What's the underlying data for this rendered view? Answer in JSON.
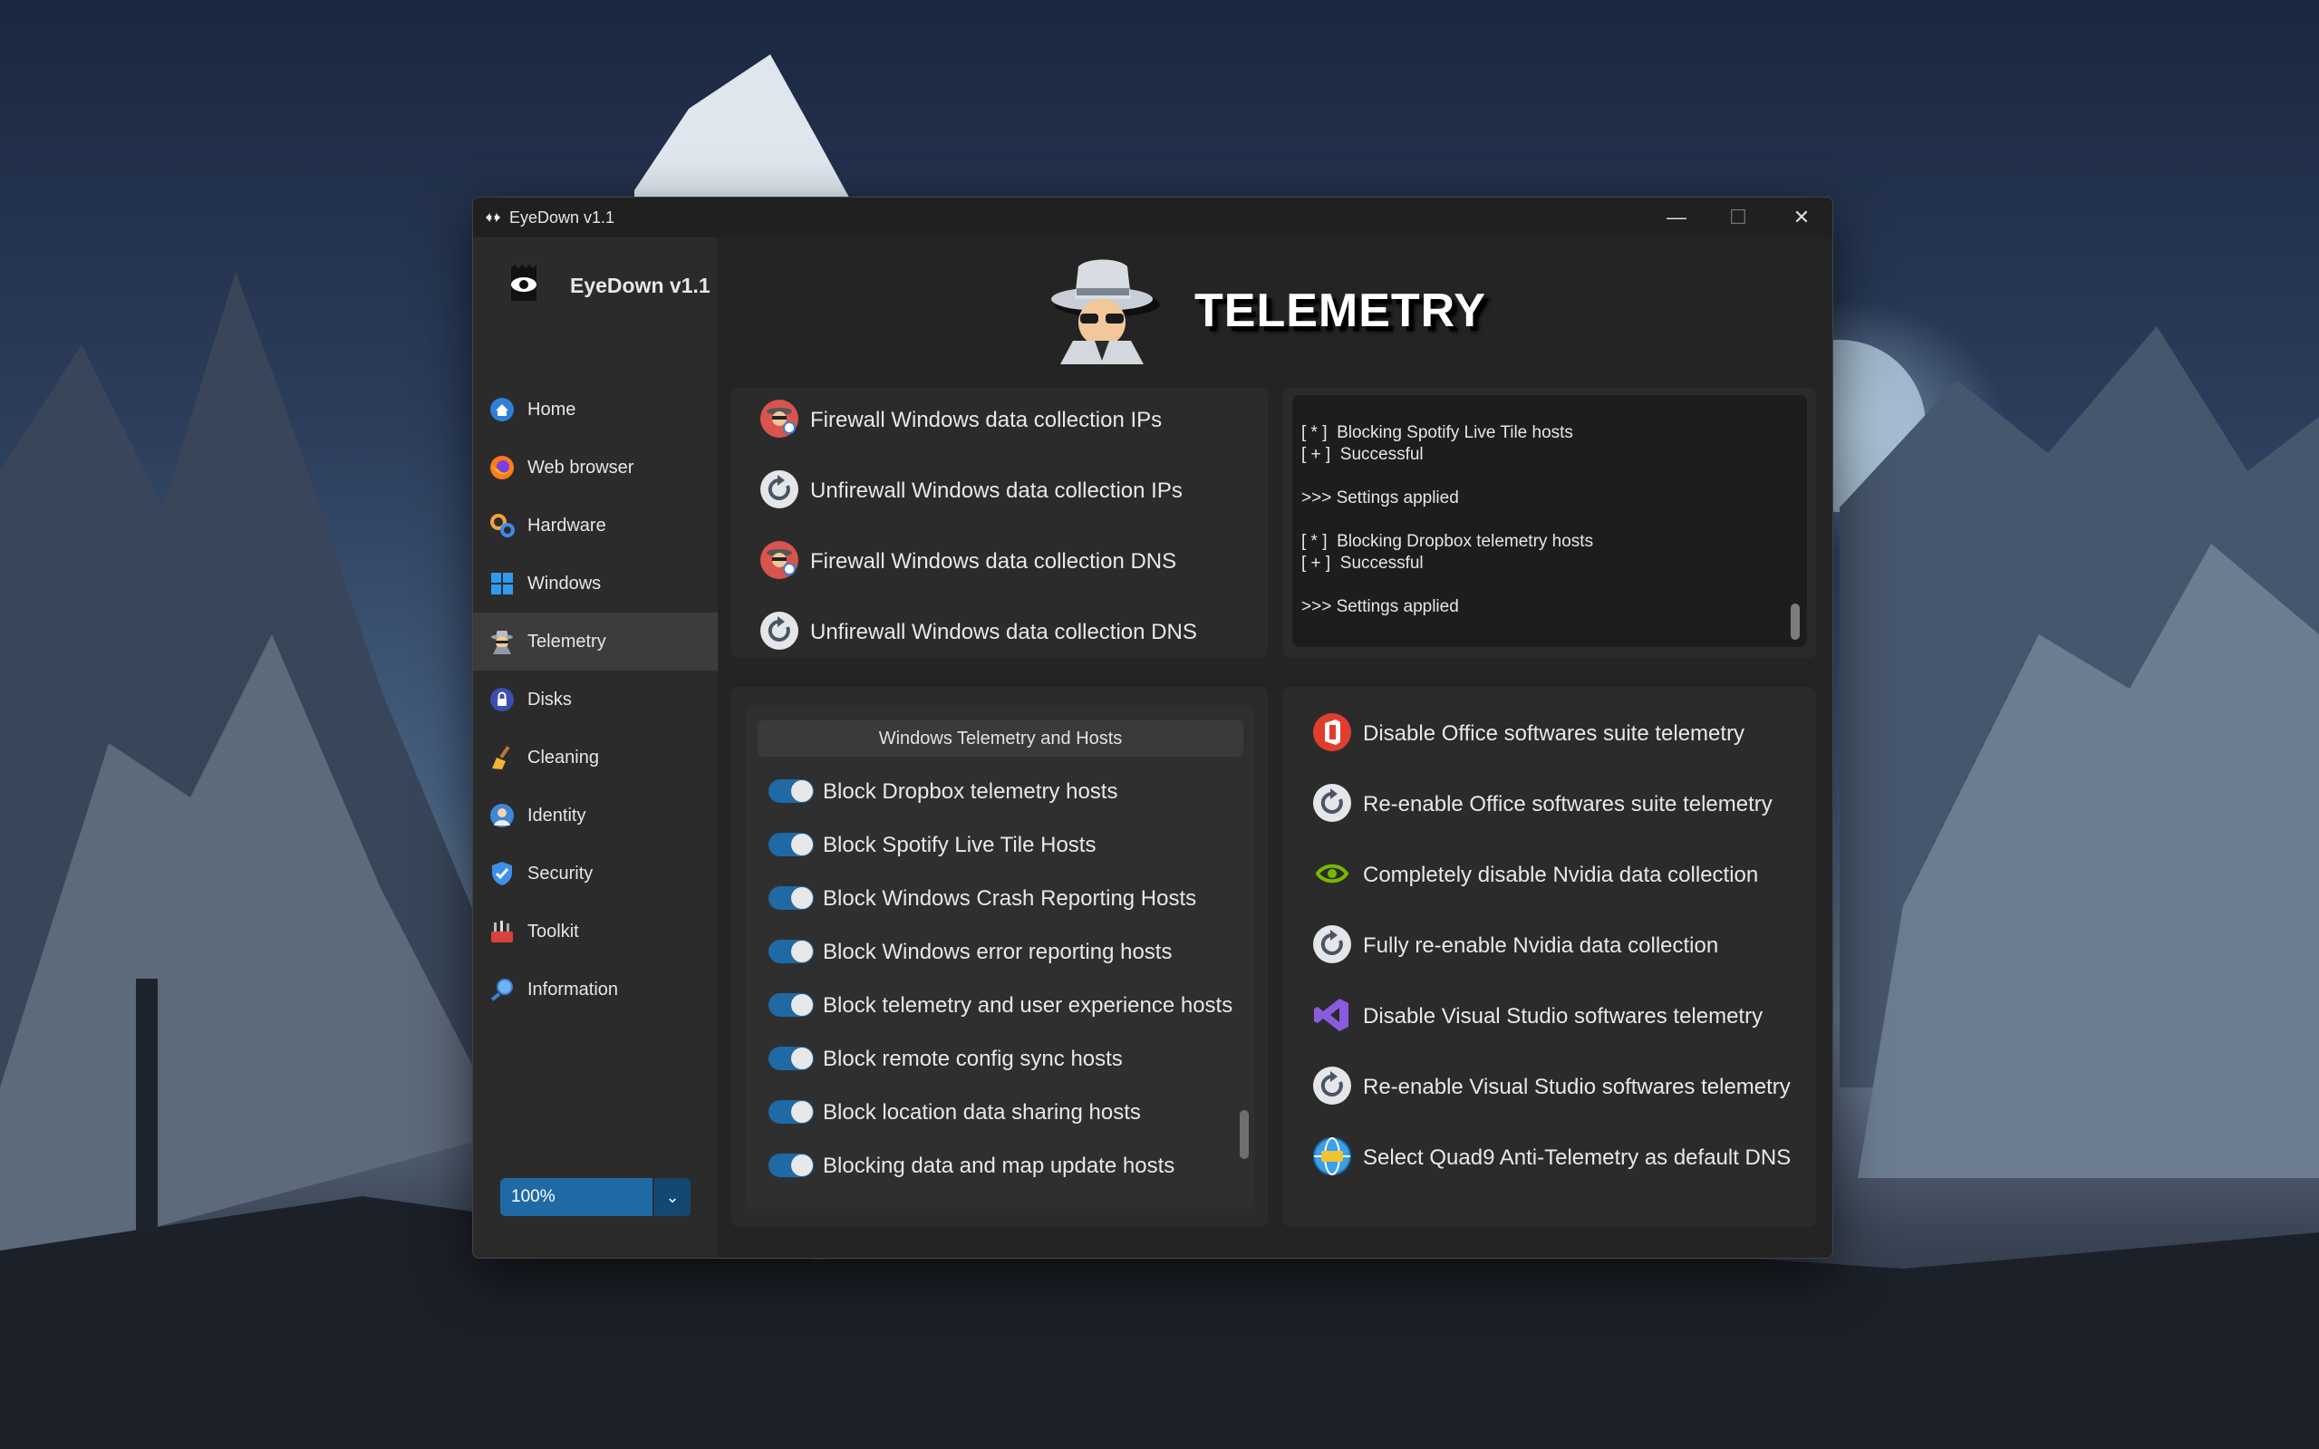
{
  "window": {
    "title": "EyeDown v1.1"
  },
  "sidebar": {
    "brand": "EyeDown v1.1",
    "items": [
      {
        "label": "Home",
        "icon": "home-icon",
        "active": false
      },
      {
        "label": "Web browser",
        "icon": "firefox-icon",
        "active": false
      },
      {
        "label": "Hardware",
        "icon": "hardware-gears-icon",
        "active": false
      },
      {
        "label": "Windows",
        "icon": "windows-logo-icon",
        "active": false
      },
      {
        "label": "Telemetry",
        "icon": "spy-agent-icon",
        "active": true
      },
      {
        "label": "Disks",
        "icon": "lock-disk-icon",
        "active": false
      },
      {
        "label": "Cleaning",
        "icon": "broom-icon",
        "active": false
      },
      {
        "label": "Identity",
        "icon": "identity-person-icon",
        "active": false
      },
      {
        "label": "Security",
        "icon": "shield-check-icon",
        "active": false
      },
      {
        "label": "Toolkit",
        "icon": "toolkit-icon",
        "active": false
      },
      {
        "label": "Information",
        "icon": "magnifier-icon",
        "active": false
      }
    ],
    "zoom": {
      "value": "100%"
    }
  },
  "header": {
    "title": "TELEMETRY",
    "icon": "spy-agent-icon"
  },
  "firewall_panel": {
    "items": [
      {
        "label": "Firewall Windows data collection IPs",
        "icon": "firewall-agent-icon"
      },
      {
        "label": "Unfirewall Windows data collection IPs",
        "icon": "refresh-icon"
      },
      {
        "label": "Firewall Windows data collection DNS",
        "icon": "firewall-agent-icon"
      },
      {
        "label": "Unfirewall Windows data collection DNS",
        "icon": "refresh-icon"
      }
    ]
  },
  "console": {
    "lines": [
      "[ * ]  Blocking Spotify Live Tile hosts",
      "[ + ]  Successful",
      ">>> Settings applied",
      "[ * ]  Blocking Dropbox telemetry hosts",
      "[ + ]  Successful",
      ">>> Settings applied"
    ]
  },
  "hosts_panel": {
    "header": "Windows Telemetry and Hosts",
    "toggles": [
      {
        "label": "Block Dropbox telemetry hosts",
        "on": true
      },
      {
        "label": "Block Spotify Live Tile Hosts",
        "on": true
      },
      {
        "label": "Block Windows Crash Reporting Hosts",
        "on": true
      },
      {
        "label": "Block Windows error reporting hosts",
        "on": true
      },
      {
        "label": "Block telemetry and user experience hosts",
        "on": true
      },
      {
        "label": "Block remote config sync hosts",
        "on": true
      },
      {
        "label": "Block location data sharing hosts",
        "on": true
      },
      {
        "label": "Blocking data and map update hosts",
        "on": true
      }
    ]
  },
  "apps_panel": {
    "items": [
      {
        "label": "Disable Office softwares suite telemetry",
        "icon": "office-icon"
      },
      {
        "label": "Re-enable Office softwares suite telemetry",
        "icon": "refresh-icon"
      },
      {
        "label": "Completely disable Nvidia data collection",
        "icon": "nvidia-icon"
      },
      {
        "label": "Fully re-enable Nvidia data collection",
        "icon": "refresh-icon"
      },
      {
        "label": "Disable Visual Studio softwares telemetry",
        "icon": "visual-studio-icon"
      },
      {
        "label": "Re-enable Visual Studio softwares telemetry",
        "icon": "refresh-icon"
      },
      {
        "label": "Select Quad9 Anti-Telemetry as default DNS",
        "icon": "dns-globe-icon"
      }
    ]
  },
  "colors": {
    "accent": "#1f6aa5",
    "window_bg": "#242424",
    "sidebar_bg": "#2b2b2b",
    "active_item": "#3c3c3c"
  }
}
